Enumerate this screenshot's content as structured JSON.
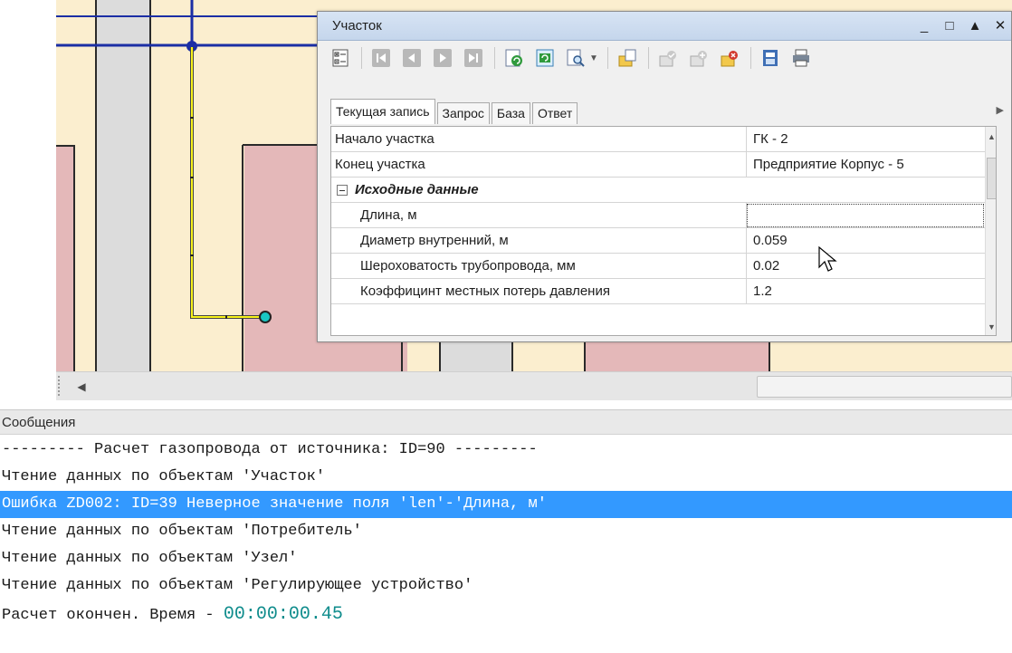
{
  "colors": {
    "background": "#ffffff",
    "parcel_pink": "#e4b8b9",
    "parcel_beige": "#fbeecf",
    "parcel_grey": "#dcdcdc",
    "pipe_blue": "#1b2ea5",
    "pipe_yellow": "#f7f21a",
    "selection_blue": "#3399ff",
    "time_teal": "#0f8c8c"
  },
  "panel": {
    "title": "Участок",
    "controls": {
      "minimize": "_",
      "maximize": "□",
      "collapse": "▲",
      "close": "✕"
    },
    "toolbar": [
      {
        "icon": "categorized-icon"
      },
      {
        "icon": "first-record-icon"
      },
      {
        "icon": "previous-record-icon"
      },
      {
        "icon": "next-record-icon"
      },
      {
        "icon": "last-record-icon"
      },
      {
        "icon": "refresh-icon"
      },
      {
        "icon": "sync-icon"
      },
      {
        "icon": "find-icon"
      },
      {
        "icon": "new-record-icon"
      },
      {
        "icon": "save-record-icon"
      },
      {
        "icon": "add-record-icon"
      },
      {
        "icon": "delete-record-icon"
      },
      {
        "icon": "export-icon"
      },
      {
        "icon": "print-icon"
      }
    ],
    "tabs": [
      "Текущая запись",
      "Запрос",
      "База",
      "Ответ"
    ],
    "active_tab": "Текущая запись",
    "properties": {
      "start": {
        "name": "Начало участка",
        "value": "ГК - 2"
      },
      "end": {
        "name": "Конец участка",
        "value": "Предприятие Корпус - 5"
      },
      "category": "Исходные данные",
      "length": {
        "name": "Длина, м",
        "value": ""
      },
      "diameter": {
        "name": "Диаметр внутренний, м",
        "value": "0.059"
      },
      "roughness": {
        "name": "Шероховатость трубопровода, мм",
        "value": "0.02"
      },
      "loss_coef": {
        "name": "Коэффицинт местных потерь давления",
        "value": "1.2"
      }
    }
  },
  "messages": {
    "title": "Сообщения",
    "lines": {
      "l1": "--------- Расчет газопровода от источника: ID=90 ---------",
      "l2": "Чтение данных по объектам 'Участок'",
      "l3": "Ошибка ZD002: ID=39 Неверное значение поля 'len'-'Длина, м'",
      "l4": "Чтение данных по объектам 'Потребитель'",
      "l5": "Чтение данных по объектам 'Узел'",
      "l6": "Чтение данных по объектам 'Регулирующее устройство'",
      "l7_prefix": "Расчет окончен. Время - ",
      "l7_time": "00:00:00.45"
    },
    "selected_line": "l3"
  }
}
